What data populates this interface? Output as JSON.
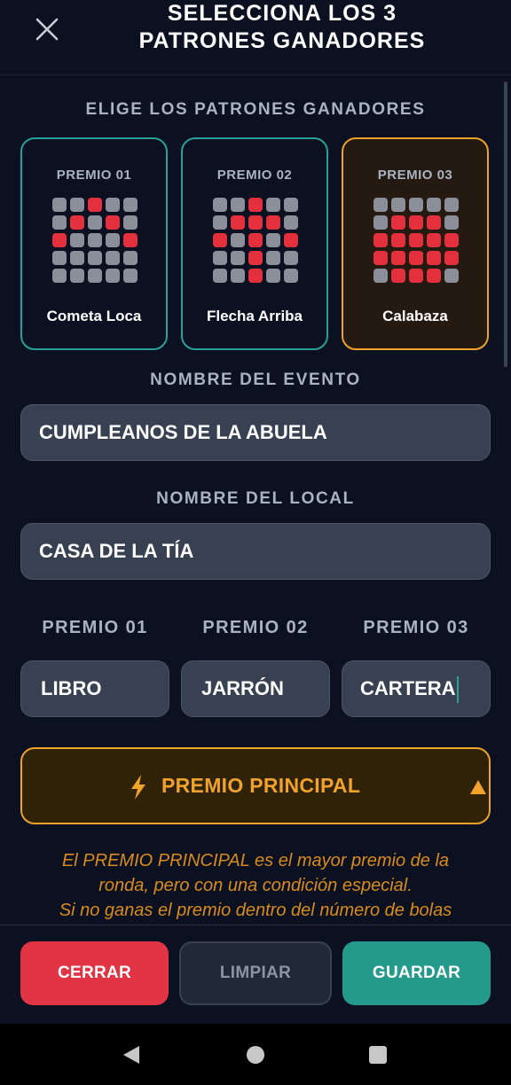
{
  "header": {
    "title_line1": "SELECCIONA LOS 3",
    "title_line2": "PATRONES GANADORES"
  },
  "patterns_section": {
    "label": "ELIGE LOS PATRONES GANADORES"
  },
  "patterns": [
    {
      "title": "PREMIO 01",
      "name": "Cometa Loca",
      "selected": false,
      "grid": [
        [
          0,
          0,
          1,
          0,
          0
        ],
        [
          0,
          1,
          0,
          1,
          0
        ],
        [
          1,
          0,
          0,
          0,
          1
        ],
        [
          0,
          0,
          0,
          0,
          0
        ],
        [
          0,
          0,
          0,
          0,
          0
        ]
      ]
    },
    {
      "title": "PREMIO 02",
      "name": "Flecha Arriba",
      "selected": false,
      "grid": [
        [
          0,
          0,
          1,
          0,
          0
        ],
        [
          0,
          1,
          1,
          1,
          0
        ],
        [
          1,
          0,
          1,
          0,
          1
        ],
        [
          0,
          0,
          1,
          0,
          0
        ],
        [
          0,
          0,
          1,
          0,
          0
        ]
      ]
    },
    {
      "title": "PREMIO 03",
      "name": "Calabaza",
      "selected": true,
      "grid": [
        [
          0,
          0,
          0,
          0,
          0
        ],
        [
          0,
          1,
          1,
          1,
          0
        ],
        [
          1,
          1,
          1,
          1,
          1
        ],
        [
          1,
          1,
          1,
          1,
          1
        ],
        [
          0,
          1,
          1,
          1,
          0
        ]
      ]
    }
  ],
  "event": {
    "label": "NOMBRE DEL EVENTO",
    "value": "CUMPLEANOS DE LA ABUELA"
  },
  "venue": {
    "label": "NOMBRE DEL LOCAL",
    "value": "CASA DE LA TÍA"
  },
  "prizes": [
    {
      "label": "PREMIO 01",
      "value": "LIBRO"
    },
    {
      "label": "PREMIO 02",
      "value": "JARRÓN"
    },
    {
      "label": "PREMIO 03",
      "value": "CARTERA"
    }
  ],
  "main_prize": {
    "icon": "lightning-icon",
    "label": "PREMIO PRINCIPAL",
    "expanded_icon": "chevron-up-icon"
  },
  "description": {
    "line1": "El PREMIO PRINCIPAL es el mayor premio de la",
    "line2": "ronda, pero con una condición especial.",
    "line3": "Si no ganas el premio dentro del número de bolas"
  },
  "footer": {
    "close_label": "CERRAR",
    "clear_label": "LIMPIAR",
    "save_label": "GUARDAR"
  },
  "colors": {
    "accent_teal": "#2aa197",
    "accent_orange": "#f0a22a",
    "red": "#e3303c",
    "background": "#0b1120"
  }
}
